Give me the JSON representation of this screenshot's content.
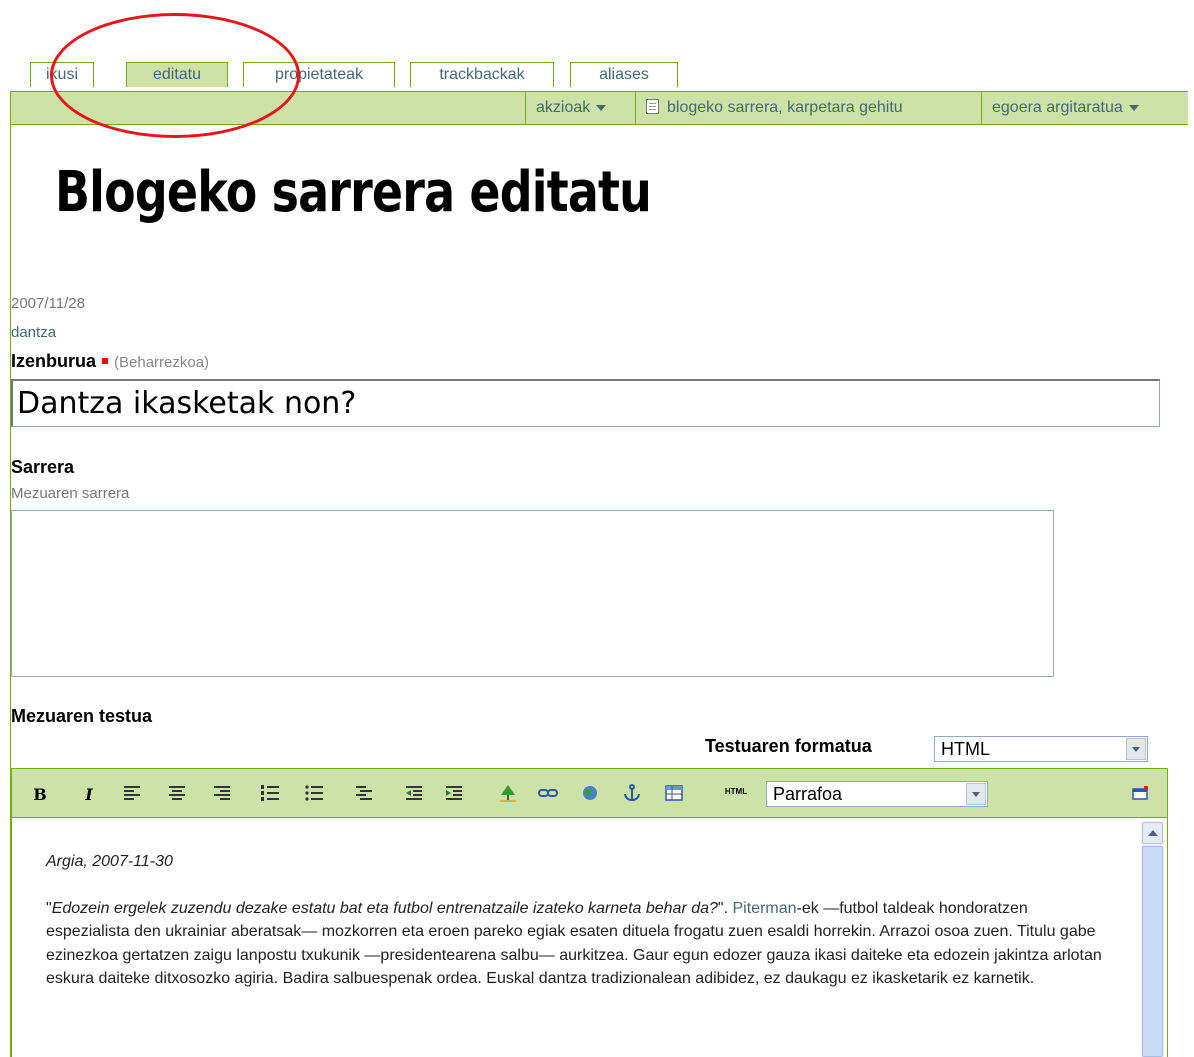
{
  "tabs": [
    {
      "label": "ikusi"
    },
    {
      "label": "editatu"
    },
    {
      "label": "propietateak"
    },
    {
      "label": "trackbackak"
    },
    {
      "label": "aliases"
    }
  ],
  "menubar": {
    "actions": "akzioak",
    "add_item": "blogeko sarrera, karpetara gehitu",
    "state": "egoera argitaratua"
  },
  "page": {
    "title": "Blogeko sarrera editatu",
    "date": "2007/11/28",
    "tag": "dantza"
  },
  "form": {
    "title_label": "Izenburua",
    "required_text": "(Beharrezkoa)",
    "title_value": "Dantza ikasketak non?",
    "description_label": "Sarrera",
    "description_help": "Mezuaren sarrera",
    "description_value": "",
    "body_label": "Mezuaren testua",
    "format_label": "Testuaren formatua",
    "format_value": "HTML",
    "style_value": "Parrafoa"
  },
  "toolbar": {
    "bold": "B",
    "italic": "I",
    "html": "HTML"
  },
  "editor": {
    "dateline": "Argia, 2007-11-30",
    "p1_quote": "Edozein ergelek zuzendu dezake estatu bat eta futbol entrenatzaile izateko karneta behar da?",
    "p1_quote_end": "\".",
    "p1_link": "Piterman",
    "p1_rest": "-ek —futbol taldeak hondoratzen espezialista den ukrainiar aberatsak— mozkorren eta eroen pareko egiak esaten dituela frogatu zuen esaldi horrekin. Arrazoi osoa zuen. Titulu gabe ezinezkoa gertatzen zaigu lanpostu txukunik —presidentearena salbu— aurkitzea. Gaur egun edozer gauza ikasi daiteke eta edozein jakintza arlotan eskura daiteke ditxosozko agiria. Badira salbuespenak ordea. Euskal dantza tradizionalean adibidez, ez daukagu ez ikasketarik ez karnetik."
  },
  "colors": {
    "accent_green": "#cde2a7",
    "border_green": "#74ae0b",
    "link_blue": "#436976",
    "annotation_red": "#e8141a"
  }
}
